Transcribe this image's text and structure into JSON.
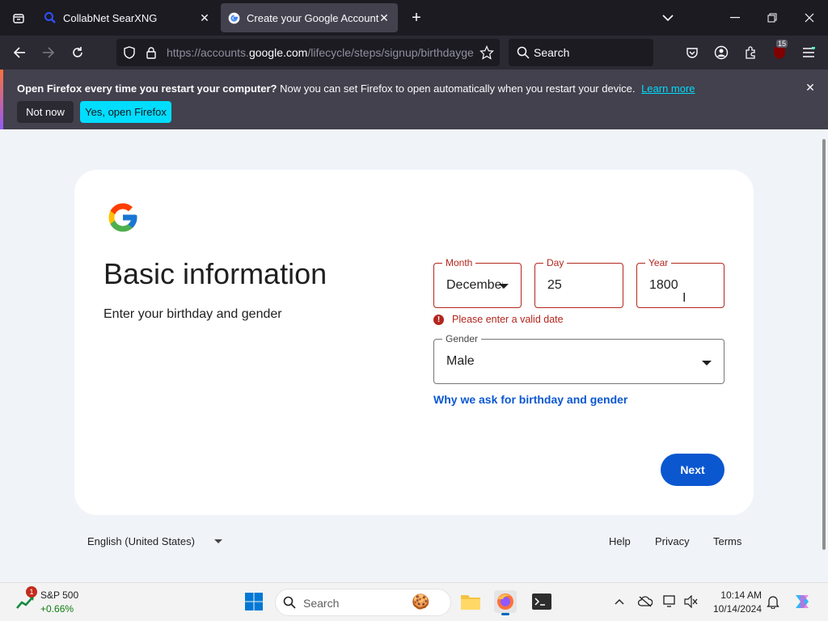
{
  "browser": {
    "tabs": [
      {
        "title": "CollabNet SearXNG",
        "icon": "search-magnifier-icon"
      },
      {
        "title": "Create your Google Account",
        "icon": "google-g-icon"
      }
    ],
    "url_prefix": "https://accounts.",
    "url_domain": "google.com",
    "url_path": "/lifecycle/steps/signup/birthdaygender",
    "search_placeholder": "Search",
    "extension_badge": "15"
  },
  "notification": {
    "bold_text": "Open Firefox every time you restart your computer?",
    "text": "Now you can set Firefox to open automatically when you restart your device.",
    "link": "Learn more",
    "not_now": "Not now",
    "yes_open": "Yes, open Firefox"
  },
  "page": {
    "title": "Basic information",
    "subtitle": "Enter your birthday and gender",
    "month_label": "Month",
    "month_value": "December",
    "day_label": "Day",
    "day_value": "25",
    "year_label": "Year",
    "year_value": "1800",
    "error": "Please enter a valid date",
    "gender_label": "Gender",
    "gender_value": "Male",
    "why_link": "Why we ask for birthday and gender",
    "next": "Next",
    "colors": {
      "primary": "#0b57d0",
      "error": "#b3261e"
    }
  },
  "footer": {
    "language": "English (United States)",
    "help": "Help",
    "privacy": "Privacy",
    "terms": "Terms"
  },
  "taskbar": {
    "stock_name": "S&P 500",
    "stock_change": "+0.66%",
    "stock_badge": "1",
    "search": "Search",
    "time": "10:14 AM",
    "date": "10/14/2024"
  }
}
